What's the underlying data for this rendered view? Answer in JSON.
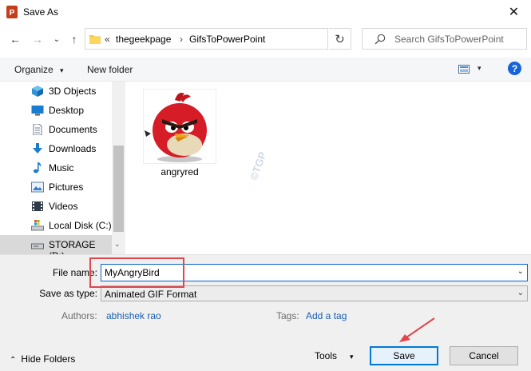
{
  "window": {
    "title": "Save As",
    "close": "✕"
  },
  "nav": {
    "back": "←",
    "forward": "→",
    "recent": "⌄",
    "up": "↑"
  },
  "address": {
    "prefix": "«",
    "crumbs": [
      "thegeekpage",
      "GifsToPowerPoint"
    ],
    "sep": "›",
    "dropdown": "⌄"
  },
  "refresh": "↻",
  "search": {
    "placeholder": "Search GifsToPowerPoint"
  },
  "toolbar": {
    "organize": "Organize",
    "new_folder": "New folder",
    "caret": "▾",
    "help": "?"
  },
  "sidebar": {
    "items": [
      {
        "label": "3D Objects",
        "icon": "3d-objects-icon"
      },
      {
        "label": "Desktop",
        "icon": "desktop-icon"
      },
      {
        "label": "Documents",
        "icon": "documents-icon"
      },
      {
        "label": "Downloads",
        "icon": "downloads-icon"
      },
      {
        "label": "Music",
        "icon": "music-icon"
      },
      {
        "label": "Pictures",
        "icon": "pictures-icon"
      },
      {
        "label": "Videos",
        "icon": "videos-icon"
      },
      {
        "label": "Local Disk (C:)",
        "icon": "local-disk-icon"
      },
      {
        "label": "STORAGE (D:)",
        "icon": "storage-drive-icon"
      }
    ]
  },
  "files": [
    {
      "name": "angryred"
    }
  ],
  "watermark": "©TGP",
  "form": {
    "file_name_label": "File name:",
    "file_name_value": "MyAngryBird",
    "save_type_label": "Save as type:",
    "save_type_value": "Animated GIF Format",
    "authors_label": "Authors:",
    "authors_value": "abhishek rao",
    "tags_label": "Tags:",
    "tags_value": "Add a tag"
  },
  "footer": {
    "hide_folders": "Hide Folders",
    "tools": "Tools",
    "save": "Save",
    "cancel": "Cancel"
  },
  "colors": {
    "accent": "#0078d7",
    "highlight": "#e0464c",
    "link": "#1a5fb4"
  }
}
